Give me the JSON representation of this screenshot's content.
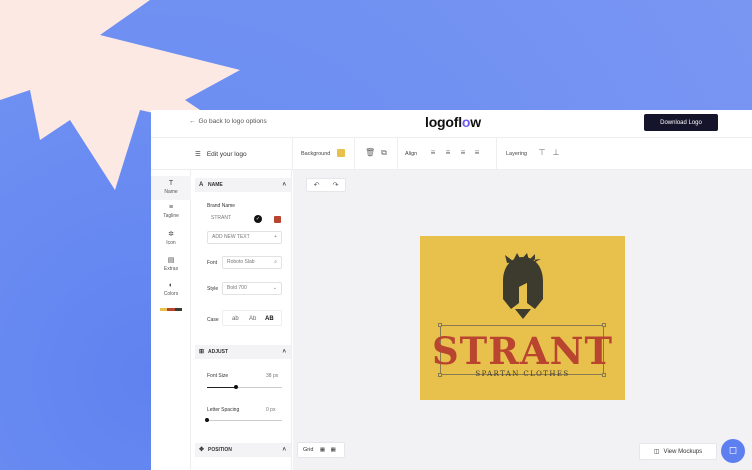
{
  "topbar": {
    "back_label": "Go back to logo options",
    "logo_prefix": "logofl",
    "logo_accent": "o",
    "logo_suffix": "w",
    "download_label": "Download Logo"
  },
  "toolbar": {
    "edit_title": "Edit your logo",
    "background_label": "Background",
    "background_color": "#e8c14d",
    "align_label": "Align",
    "layering_label": "Layering"
  },
  "rail": {
    "items": [
      {
        "label": "Name",
        "icon": "text-icon"
      },
      {
        "label": "Tagline",
        "icon": "tagline-icon"
      },
      {
        "label": "Icon",
        "icon": "star-icon"
      },
      {
        "label": "Extras",
        "icon": "extras-icon"
      },
      {
        "label": "Colors",
        "icon": "palette-icon"
      }
    ],
    "color_strip": [
      "#e8c14d",
      "#b9442f",
      "#3d3a2e"
    ]
  },
  "panel": {
    "name_section": "NAME",
    "brand_name_label": "Brand Name",
    "brand_name_value": "STRANT",
    "brand_color": "#b9442f",
    "add_text_placeholder": "ADD NEW TEXT",
    "add_text_plus": "+",
    "font_label": "Font",
    "font_value": "Roboto Slab",
    "style_label": "Style",
    "style_value": "Bold 700",
    "case_label": "Case",
    "case_options": [
      "ab",
      "Ab",
      "AB"
    ],
    "adjust_section": "ADJUST",
    "font_size_label": "Font Size",
    "font_size_value": "38",
    "font_size_unit": "px",
    "letter_spacing_label": "Letter Spacing",
    "letter_spacing_value": "0",
    "letter_spacing_unit": "px",
    "position_section": "POSITION"
  },
  "canvas": {
    "brand_text": "STRANT",
    "tagline_text": "SPARTAN CLOTHES",
    "grid_label": "Grid",
    "view_mockups_label": "View Mockups"
  }
}
